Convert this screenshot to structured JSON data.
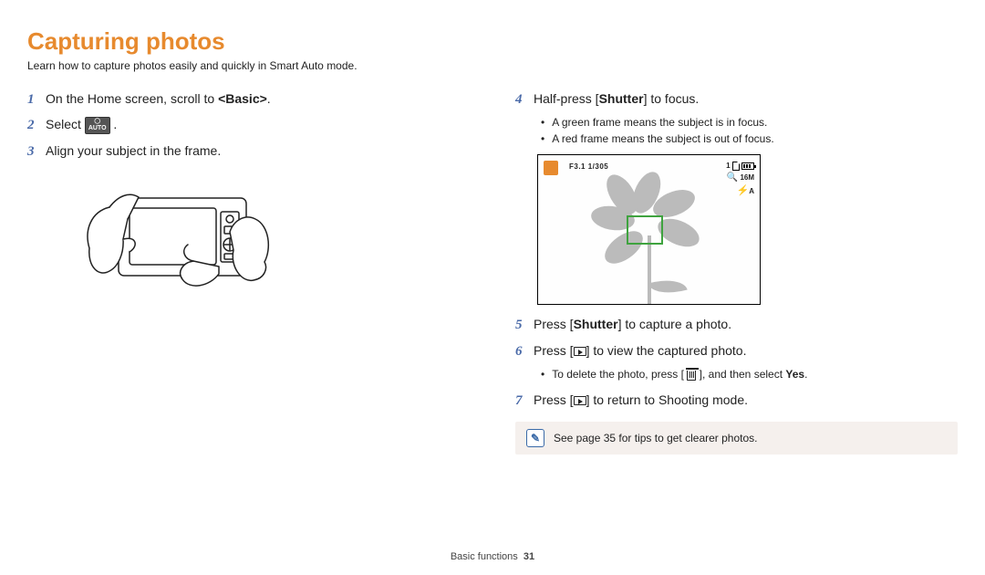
{
  "title": "Capturing photos",
  "intro": "Learn how to capture photos easily and quickly in Smart Auto mode.",
  "left": {
    "step1_num": "1",
    "step1_a": "On the Home screen, scroll to ",
    "step1_b": "<Basic>",
    "step1_c": ".",
    "step2_num": "2",
    "step2_a": "Select ",
    "step2_icon_label": "AUTO",
    "step2_b": ".",
    "step3_num": "3",
    "step3": "Align your subject in the frame."
  },
  "right": {
    "step4_num": "4",
    "step4_a": "Half-press [",
    "step4_b": "Shutter",
    "step4_c": "] to focus.",
    "step4_bullets": [
      "A green frame means the subject is in focus.",
      "A red frame means the subject is out of focus."
    ],
    "lcd": {
      "exposure": "F3.1  1/305",
      "count": "1",
      "size": "16M",
      "flash": "A"
    },
    "step5_num": "5",
    "step5_a": "Press [",
    "step5_b": "Shutter",
    "step5_c": "] to capture a photo.",
    "step6_num": "6",
    "step6_a": "Press [",
    "step6_b": "] to view the captured photo.",
    "step6_bullet_a": "To delete the photo, press [ ",
    "step6_bullet_b": " ], and then select ",
    "step6_bullet_c": "Yes",
    "step6_bullet_d": ".",
    "step7_num": "7",
    "step7_a": "Press [",
    "step7_b": "] to return to Shooting mode.",
    "note": "See page 35 for tips to get clearer photos."
  },
  "footer": {
    "section": "Basic functions",
    "page": "31"
  }
}
